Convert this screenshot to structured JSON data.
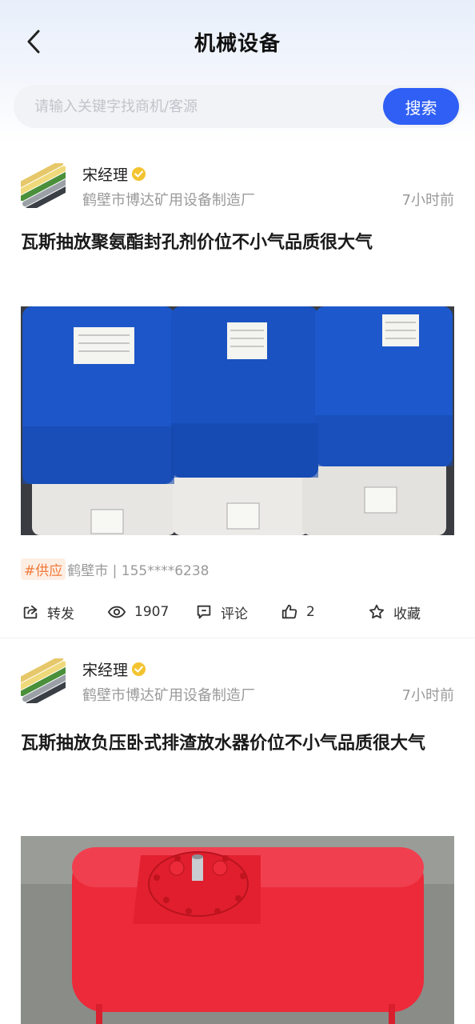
{
  "header": {
    "title": "机械设备",
    "back_icon": "chevron-left-icon"
  },
  "search": {
    "placeholder": "请输入关键字找商机/客源",
    "button_label": "搜索",
    "accent_color": "#2f5ff5"
  },
  "posts": [
    {
      "author": "宋经理",
      "company": "鹤壁市博达矿用设备制造厂",
      "time": "7小时前",
      "title": "瓦斯抽放聚氨酯封孔剂价位不小气品质很大气",
      "tag": "#供应",
      "location_phone": "鹤壁市 | 155****6238",
      "actions": {
        "share": "转发",
        "views": "1907",
        "comment": "评论",
        "likes": "2",
        "favorite": "收藏"
      }
    },
    {
      "author": "宋经理",
      "company": "鹤壁市博达矿用设备制造厂",
      "time": "7小时前",
      "title": "瓦斯抽放负压卧式排渣放水器价位不小气品质很大气"
    }
  ]
}
